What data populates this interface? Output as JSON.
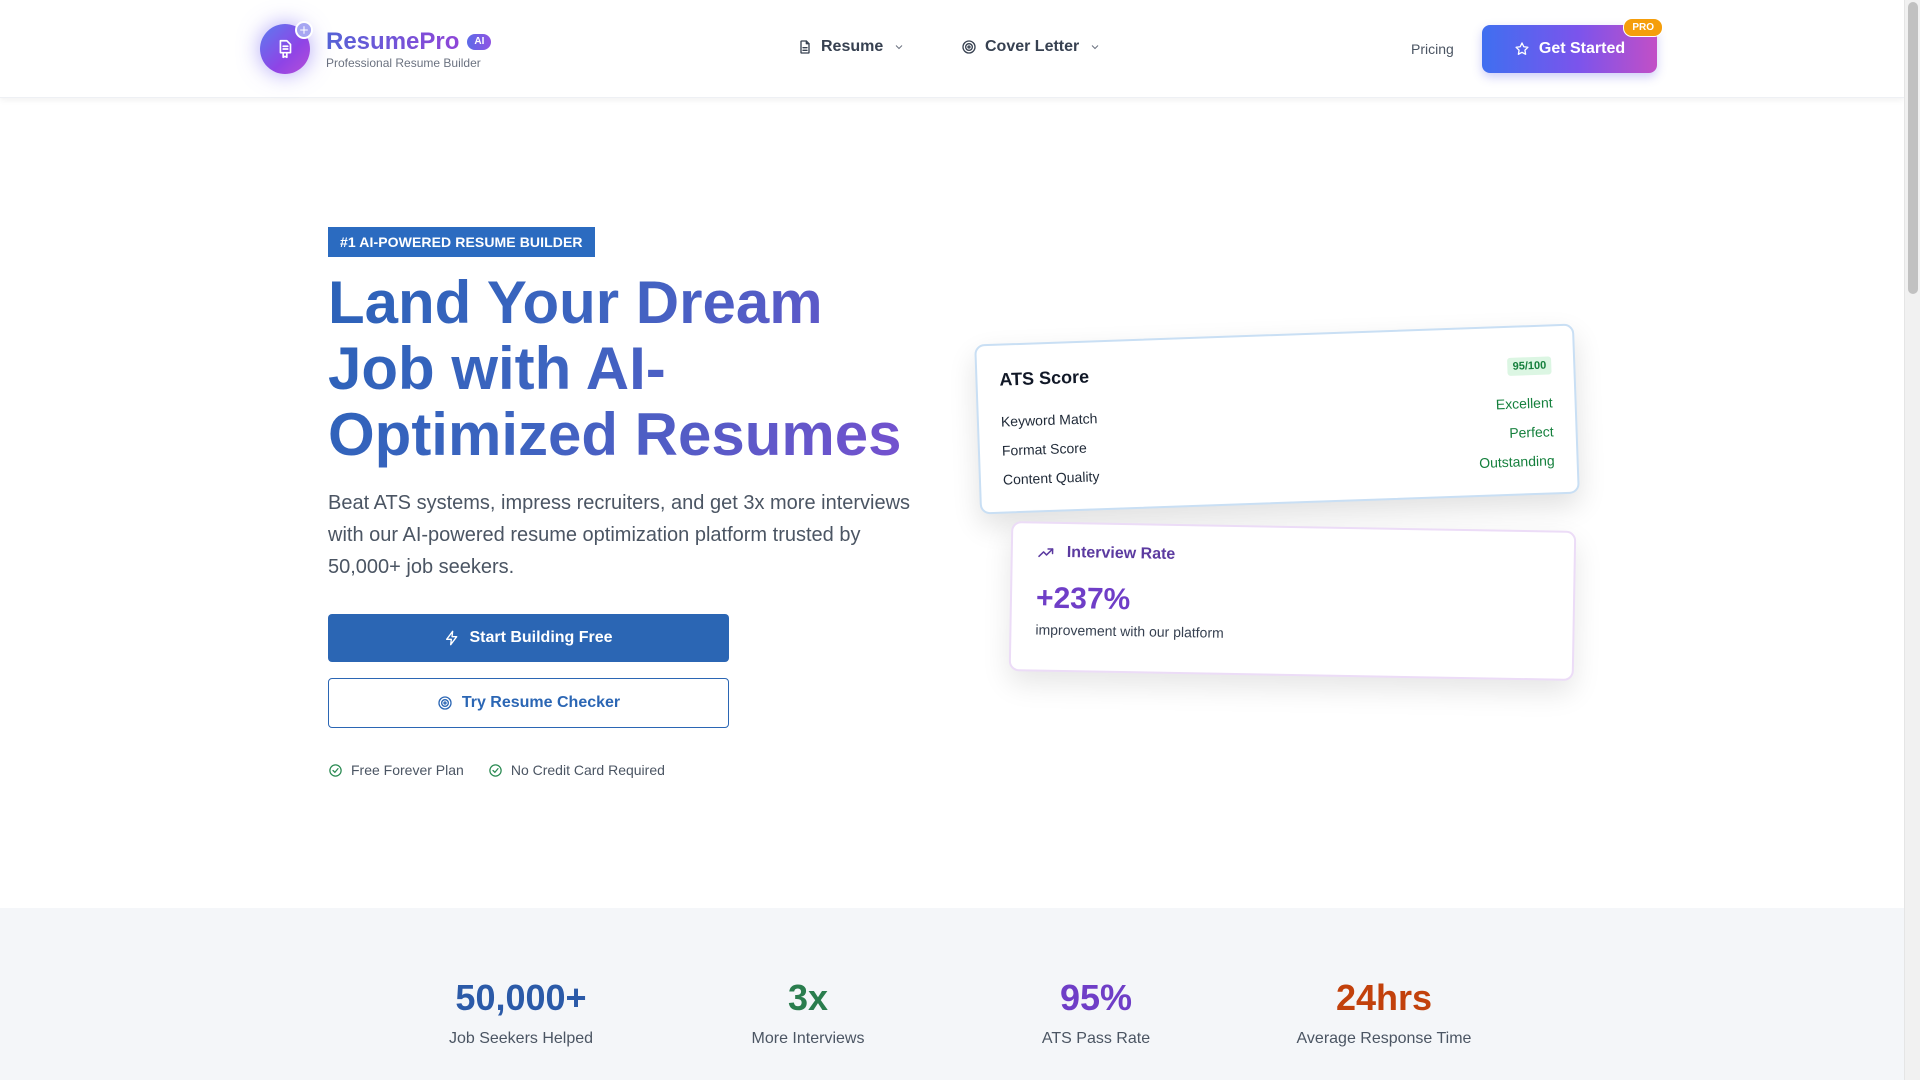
{
  "header": {
    "brand_name": "ResumePro",
    "ai_badge": "AI",
    "brand_subtitle": "Professional Resume Builder",
    "nav": [
      {
        "label": "Resume",
        "icon": "document-icon"
      },
      {
        "label": "Cover Letter",
        "icon": "target-icon"
      }
    ],
    "pricing_label": "Pricing",
    "cta_label": "Get Started",
    "cta_badge": "PRO"
  },
  "hero": {
    "tagline": "#1 AI-POWERED RESUME BUILDER",
    "title": "Land Your Dream Job with AI-Optimized Resumes",
    "description": "Beat ATS systems, impress recruiters, and get 3x more interviews with our AI-powered resume optimization platform trusted by 50,000+ job seekers.",
    "primary_button": "Start Building Free",
    "secondary_button": "Try Resume Checker",
    "perks": [
      "Free Forever Plan",
      "No Credit Card Required"
    ]
  },
  "ats_card": {
    "title": "ATS Score",
    "score": "95/100",
    "rows": [
      {
        "label": "Keyword Match",
        "value": "Excellent"
      },
      {
        "label": "Format Score",
        "value": "Perfect"
      },
      {
        "label": "Content Quality",
        "value": "Outstanding"
      }
    ]
  },
  "interview_card": {
    "title": "Interview Rate",
    "value": "+237%",
    "subtitle": "improvement with our platform"
  },
  "stats": [
    {
      "value": "50,000+",
      "label": "Job Seekers Helped"
    },
    {
      "value": "3x",
      "label": "More Interviews"
    },
    {
      "value": "95%",
      "label": "ATS Pass Rate"
    },
    {
      "value": "24hrs",
      "label": "Average Response Time"
    }
  ],
  "colors": {
    "primary": "#2b66b4",
    "accent_purple": "#6f3ec7",
    "success_green": "#15803d",
    "orange": "#c2410c"
  }
}
